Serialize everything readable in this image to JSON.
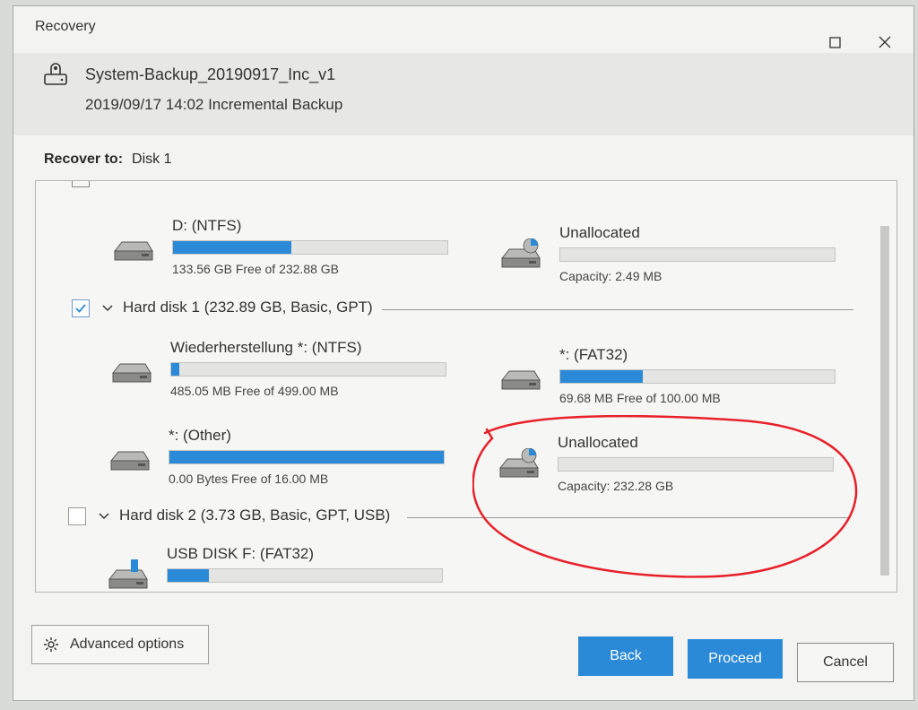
{
  "window": {
    "title": "Recovery",
    "maximize_icon": "maximize-icon",
    "close_icon": "close-icon"
  },
  "backup": {
    "name": "System-Backup_20190917_Inc_v1",
    "description": "2019/09/17 14:02 Incremental Backup",
    "icon": "disk-backup-icon"
  },
  "recover_to": {
    "label": "Recover to:",
    "value": "Disk 1"
  },
  "partitions_top": [
    {
      "name": "D: (NTFS)",
      "info": "133.56 GB Free of 232.88 GB",
      "fill": 0.43,
      "type": "drive"
    },
    {
      "name": "Unallocated",
      "info": "Capacity: 2.49 MB",
      "fill": 0,
      "type": "unallocated"
    }
  ],
  "disks": [
    {
      "label": "Hard disk 1 (232.89 GB, Basic, GPT)",
      "checked": true,
      "partitions": [
        {
          "name": "Wiederherstellung *: (NTFS)",
          "info": "485.05 MB Free of 499.00 MB",
          "fill": 0.03,
          "type": "drive"
        },
        {
          "name": "*: (FAT32)",
          "info": "69.68 MB Free of 100.00 MB",
          "fill": 0.3,
          "type": "drive"
        },
        {
          "name": "*: (Other)",
          "info": "0.00 Bytes Free of 16.00 MB",
          "fill": 1.0,
          "type": "drive"
        },
        {
          "name": "Unallocated",
          "info": "Capacity: 232.28 GB",
          "fill": 0,
          "type": "unallocated"
        }
      ]
    },
    {
      "label": "Hard disk 2 (3.73 GB, Basic, GPT, USB)",
      "checked": false,
      "partitions": [
        {
          "name": "USB DISK F: (FAT32)",
          "info": "",
          "fill": 0.15,
          "type": "usb"
        }
      ]
    }
  ],
  "buttons": {
    "advanced": "Advanced options",
    "back": "Back",
    "proceed": "Proceed",
    "cancel": "Cancel"
  },
  "colors": {
    "accent": "#2b8ad8",
    "annotation": "#e8202a"
  }
}
